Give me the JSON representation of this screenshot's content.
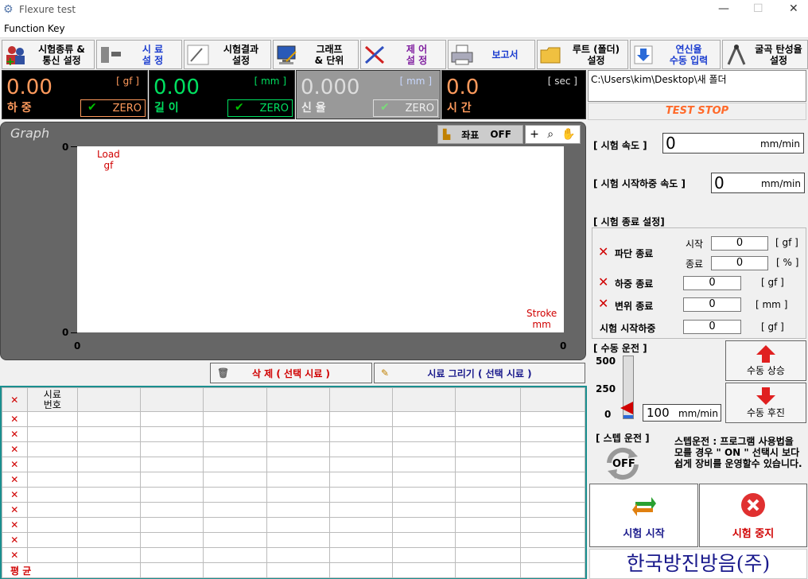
{
  "window": {
    "title": "Flexure test",
    "min": "—",
    "max": "☐",
    "close": "✕"
  },
  "menu": {
    "function_key": "Function Key"
  },
  "toolbar": [
    {
      "label": "시험종류 &\n통신 설정",
      "icon": "test-type-icon"
    },
    {
      "label": "시  료\n설  정",
      "icon": "sample-icon"
    },
    {
      "label": "시험결과\n설정",
      "icon": "pencil-icon"
    },
    {
      "label": "그래프\n& 단위",
      "icon": "monitor-icon"
    },
    {
      "label": "제  어\n설  정",
      "icon": "tools-icon"
    },
    {
      "label": "보고서",
      "icon": "printer-icon"
    },
    {
      "label": "루트 (폴더)\n설정",
      "icon": "folder-icon"
    },
    {
      "label": "연신율\n수동 입력",
      "icon": "arrow-down-icon"
    },
    {
      "label": "굴곡 탄성율\n설정",
      "icon": "compass-icon"
    }
  ],
  "readouts": [
    {
      "value": "0.00",
      "unit": "[ gf ]",
      "name": "하 중",
      "zero": "ZERO"
    },
    {
      "value": "0.00",
      "unit": "[ mm ]",
      "name": "길 이",
      "zero": "ZERO"
    },
    {
      "value": "0.000",
      "unit": "[ mm ]",
      "name": "신 율",
      "zero": "ZERO"
    },
    {
      "value": "0.0",
      "unit": "[ sec ]",
      "name": "시 간"
    }
  ],
  "path": "C:\\Users\\kim\\Desktop\\새 폴더",
  "test_status": "TEST STOP",
  "graph": {
    "title": "Graph",
    "coord_label": "좌표",
    "coord_state": "OFF",
    "y_label": "Load",
    "y_unit": "gf",
    "x_label": "Stroke",
    "x_unit": "mm",
    "y_top": "0",
    "y_bottom": "0",
    "x_left": "0",
    "x_right": "0"
  },
  "actions": {
    "delete": "삭 제 ( 선택 시료 )",
    "draw": "시료 그리기 ( 선택 시료 )"
  },
  "table": {
    "header": "시료\n번호",
    "rows": 10,
    "average": "평  균"
  },
  "settings": {
    "speed_label": "[ 시험 속도 ]",
    "speed_value": "0",
    "speed_unit": "mm/min",
    "start_speed_label": "[ 시험 시작하중 속도 ]",
    "start_speed_value": "0",
    "start_speed_unit": "mm/min",
    "end_label": "[ 시험 종료 설정]",
    "break_end": "파단 종료",
    "start": "시작",
    "start_val": "0",
    "start_unit": "[ gf ]",
    "end": "종료",
    "end_val": "0",
    "end_unit": "[ % ]",
    "load_end": "하중 종료",
    "load_end_val": "0",
    "load_end_unit": "[ gf ]",
    "disp_end": "변위 종료",
    "disp_end_val": "0",
    "disp_end_unit": "[ mm ]",
    "start_load": "시험 시작하중",
    "start_load_val": "0",
    "start_load_unit": "[ gf ]"
  },
  "manual": {
    "label": "[ 수동 운전 ]",
    "scale_top": "500",
    "scale_mid": "250",
    "scale_bot": "0",
    "speed": "100",
    "speed_unit": "mm/min",
    "up": "수동 상승",
    "down": "수동 후진",
    "slider_level": 0.05
  },
  "step": {
    "label": "[ 스텝 운전 ]",
    "state": "OFF",
    "desc": "스텝운전 : 프로그램 사용법을 모를 경우 \" ON \" 선택시 보다 쉽게 장비를 운영할수 있습니다."
  },
  "controls": {
    "start": "시험 시작",
    "stop": "시험 중지"
  },
  "company": "한국방진방음(주)",
  "colors": {
    "accent": "#ff9a5c",
    "green": "#00c000",
    "teal": "#1a8f8f",
    "red": "#d00000",
    "navy": "#1a1a8c"
  }
}
